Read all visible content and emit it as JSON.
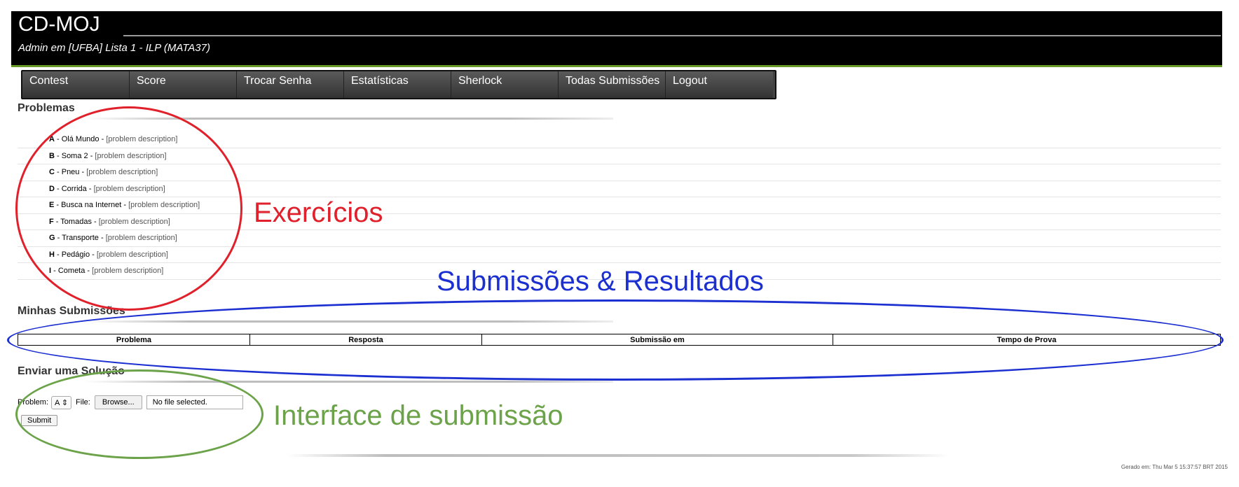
{
  "header": {
    "title": "CD-MOJ",
    "subtitle": "Admin em [UFBA] Lista 1 - ILP (MATA37)"
  },
  "menu": {
    "items": [
      {
        "label": "Contest"
      },
      {
        "label": "Score"
      },
      {
        "label": "Trocar Senha"
      },
      {
        "label": "Estatísticas"
      },
      {
        "label": "Sherlock"
      },
      {
        "label": "Todas Submissões"
      },
      {
        "label": "Logout"
      }
    ]
  },
  "problems": {
    "title": "Problemas",
    "desc_label": "[problem description]",
    "items": [
      {
        "letter": "A",
        "name": " - Olá Mundo - "
      },
      {
        "letter": "B",
        "name": " - Soma 2 - "
      },
      {
        "letter": "C",
        "name": " - Pneu - "
      },
      {
        "letter": "D",
        "name": " - Corrida - "
      },
      {
        "letter": "E",
        "name": " - Busca na Internet - "
      },
      {
        "letter": "F",
        "name": " - Tomadas - "
      },
      {
        "letter": "G",
        "name": " - Transporte - "
      },
      {
        "letter": "H",
        "name": " - Pedágio - "
      },
      {
        "letter": "I",
        "name": " - Cometa - "
      }
    ]
  },
  "submissions": {
    "title": "Minhas Submissões",
    "columns": [
      "Problema",
      "Resposta",
      "Submissão em",
      "Tempo de Prova"
    ]
  },
  "submit_form": {
    "title": "Enviar uma Solução",
    "problem_label": "Problem:",
    "problem_value": "A",
    "file_label": "File:",
    "browse_label": "Browse...",
    "file_status": "No file selected.",
    "submit_label": "Submit"
  },
  "footer": {
    "generated": "Gerado em: Thu Mar 5 15:37:57 BRT 2015"
  },
  "annotations": {
    "exercises": "Exercícios",
    "results": "Submissões & Resultados",
    "interface": "Interface de submissão"
  },
  "colors": {
    "annotation_red": "#e0202a",
    "annotation_blue": "#1c2fd1",
    "annotation_green": "#6ca34a"
  }
}
